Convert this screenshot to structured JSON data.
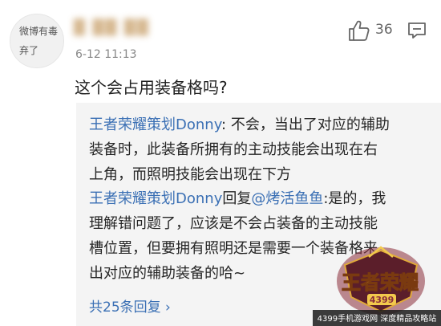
{
  "comment": {
    "avatar_text": [
      "微博有毒",
      "弃了"
    ],
    "username": "█ ██ ██",
    "timestamp": "6-12 11:13",
    "like_count": "36",
    "text": "这个会占用装备格吗?",
    "icons": {
      "like": "thumbs-up-icon",
      "reply": "comment-icon"
    }
  },
  "replies": [
    {
      "author": "王者荣耀策划Donny",
      "separator": ": ",
      "text_line1": "不会，当出了对应的辅助",
      "text_line2": "装备时，此装备所拥有的主动技能会出现在右",
      "text_line3": "上角，而照明技能会出现在下方"
    },
    {
      "author": "王者荣耀策划Donny",
      "reply_word": "回复",
      "mention": "@烤活鱼鱼",
      "text_line1": ":是的，我",
      "text_line2": "理解错问题了，应该是不会占装备的主动技能",
      "text_line3": "槽位置，但要拥有照明还是需要一个装备格来",
      "text_line4": "出对应的辅助装备的哈~"
    }
  ],
  "more_replies": "共25条回复 ›",
  "watermark": {
    "title": "王者荣耀",
    "badge": "4399",
    "tagline": "4399手机游戏网 深度精品攻略站"
  },
  "colors": {
    "link": "#3a6fb4",
    "timestamp": "#888888",
    "reply_bg": "#f4f4f4",
    "watermark_gold": "#f2c94c"
  }
}
